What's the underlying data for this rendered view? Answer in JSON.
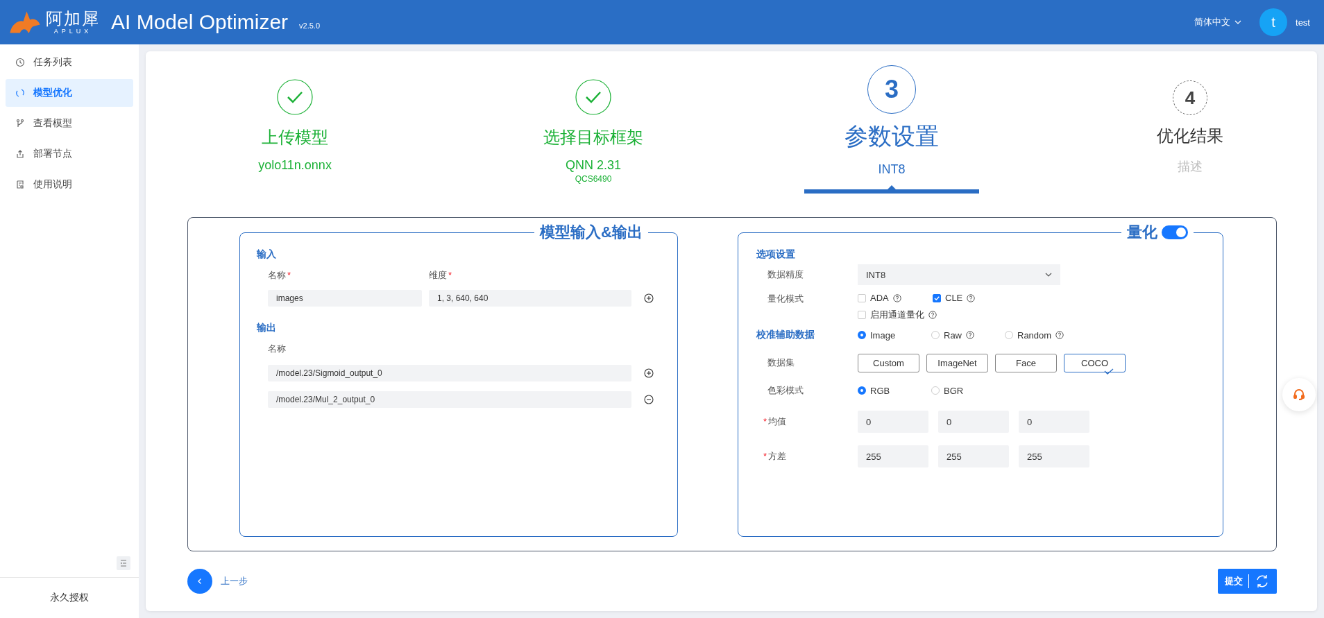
{
  "header": {
    "logo_text": "阿加犀",
    "logo_sub": "APLUX",
    "title": "AI Model Optimizer",
    "version": "v2.5.0",
    "language": "简体中文",
    "avatar": "t",
    "user": "test"
  },
  "sidebar": {
    "items": [
      {
        "label": "任务列表",
        "selected": false
      },
      {
        "label": "模型优化",
        "selected": true
      },
      {
        "label": "查看模型",
        "selected": false
      },
      {
        "label": "部署节点",
        "selected": false
      },
      {
        "label": "使用说明",
        "selected": false
      }
    ],
    "footer": "永久授权"
  },
  "steps": [
    {
      "kind": "done",
      "title": "上传模型",
      "subtitle": "yolo11n.onnx"
    },
    {
      "kind": "done",
      "title": "选择目标框架",
      "subtitle": "QNN 2.31",
      "note": "QCS6490"
    },
    {
      "kind": "active",
      "number": "3",
      "title": "参数设置",
      "subtitle": "INT8"
    },
    {
      "kind": "pending",
      "number": "4",
      "title": "优化结果",
      "subtitle": "描述"
    }
  ],
  "io_panel": {
    "title": "模型输入&输出",
    "input": {
      "heading": "输入",
      "columns": [
        {
          "label": "名称",
          "marker": "*"
        },
        {
          "label": "维度",
          "marker": "*"
        }
      ],
      "values": [
        "images",
        "1, 3, 640, 640"
      ]
    },
    "output": {
      "heading": "输出",
      "column": {
        "label": "名称"
      },
      "rows": [
        {
          "value": "/model.23/Sigmoid_output_0",
          "kind": "add"
        },
        {
          "value": "/model.23/Mul_2_output_0",
          "kind": "remove"
        }
      ]
    }
  },
  "quant_panel": {
    "title": "量化",
    "enabled": true,
    "options_heading": "选项设置",
    "precision": {
      "label": "数据精度",
      "value": "INT8"
    },
    "mode": {
      "label": "量化模式",
      "options": [
        {
          "label": "ADA",
          "checked": false,
          "help": true
        },
        {
          "label": "CLE",
          "checked": true,
          "help": true
        },
        {
          "label": "启用通道量化",
          "checked": false,
          "help": true
        }
      ]
    },
    "calibration": {
      "heading": "校准辅助数据",
      "options": [
        {
          "label": "Image",
          "selected": true,
          "help": false
        },
        {
          "label": "Raw",
          "selected": false,
          "help": true
        },
        {
          "label": "Random",
          "selected": false,
          "help": true
        }
      ]
    },
    "dataset": {
      "label": "数据集",
      "options": [
        {
          "label": "Custom",
          "selected": false
        },
        {
          "label": "ImageNet",
          "selected": false
        },
        {
          "label": "Face",
          "selected": false
        },
        {
          "label": "COCO",
          "selected": true
        }
      ]
    },
    "color_mode": {
      "label": "色彩模式",
      "options": [
        {
          "label": "RGB",
          "selected": true
        },
        {
          "label": "BGR",
          "selected": false
        }
      ]
    },
    "mean": {
      "label": "均值",
      "marker": "*",
      "values": [
        "0",
        "0",
        "0"
      ]
    },
    "variance": {
      "label": "方差",
      "marker": "*",
      "values": [
        "255",
        "255",
        "255"
      ]
    }
  },
  "footer": {
    "back": "上一步",
    "submit": "提交"
  }
}
